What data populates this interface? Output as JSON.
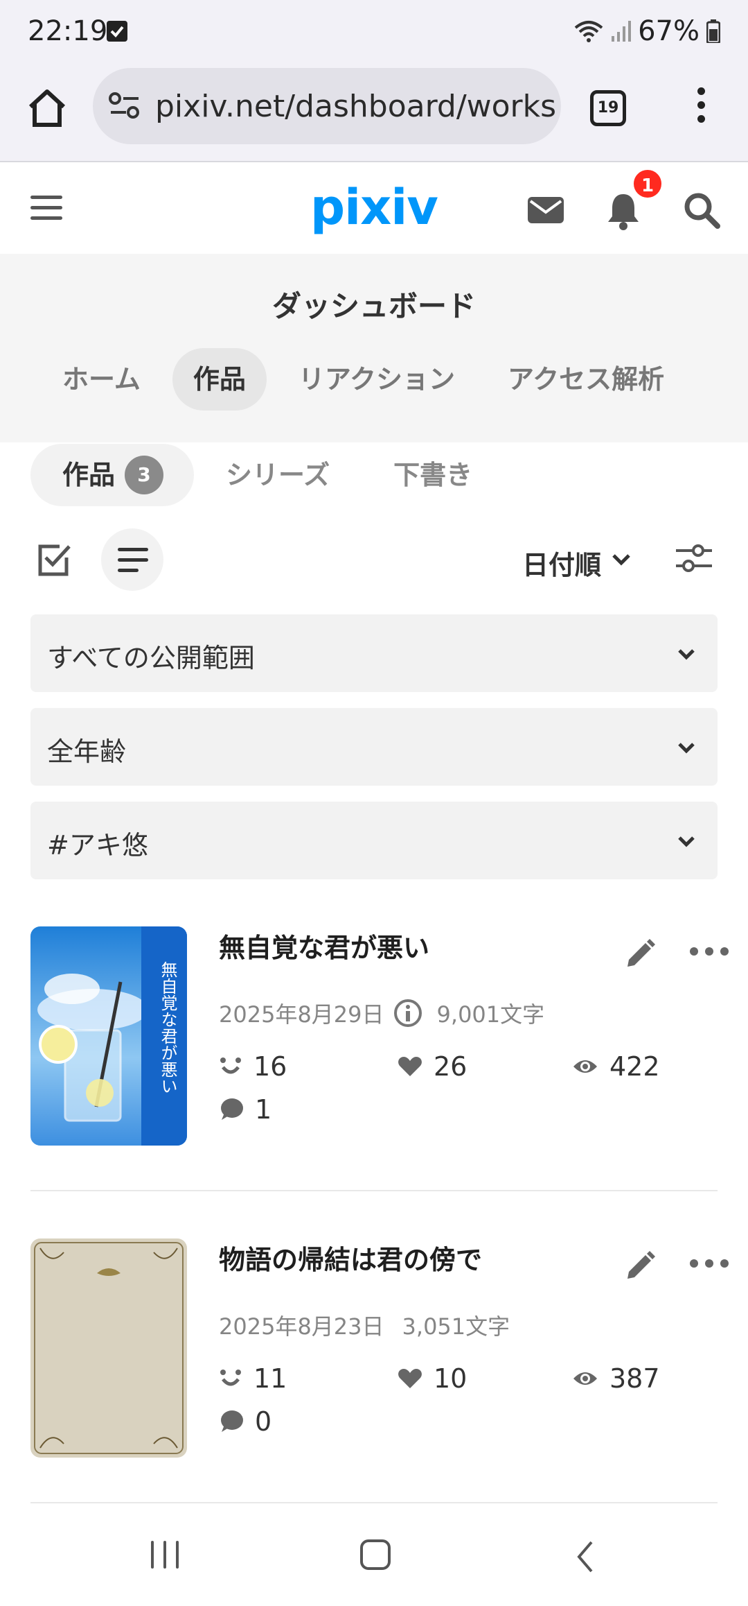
{
  "status_bar": {
    "time": "22:19",
    "battery": "67%"
  },
  "browser": {
    "url": "pixiv.net/dashboard/works",
    "tab_count": "19"
  },
  "header": {
    "logo": "pixiv",
    "notification_count": "1"
  },
  "dashboard": {
    "title": "ダッシュボード",
    "tabs": [
      {
        "label": "ホーム"
      },
      {
        "label": "作品"
      },
      {
        "label": "リアクション"
      },
      {
        "label": "アクセス解析"
      }
    ]
  },
  "sub_tabs": {
    "works_label": "作品",
    "works_count": "3",
    "series_label": "シリーズ",
    "drafts_label": "下書き"
  },
  "toolbar": {
    "sort_label": "日付順"
  },
  "filters": {
    "visibility": "すべての公開範囲",
    "age_rating": "全年齢",
    "tag": "#アキ悠"
  },
  "works": [
    {
      "title": "無自覚な君が悪い",
      "date": "2025年8月29日",
      "char_count": "9,001文字",
      "cover_text": "無自覚な君が悪い",
      "reactions": "16",
      "likes": "26",
      "views": "422",
      "comments": "1"
    },
    {
      "title": "物語の帰結は君の傍で",
      "date": "2025年8月23日",
      "char_count": "3,051文字",
      "reactions": "11",
      "likes": "10",
      "views": "387",
      "comments": "0"
    }
  ],
  "colors": {
    "brand": "#0096fa",
    "badge": "#ff2a1f"
  }
}
